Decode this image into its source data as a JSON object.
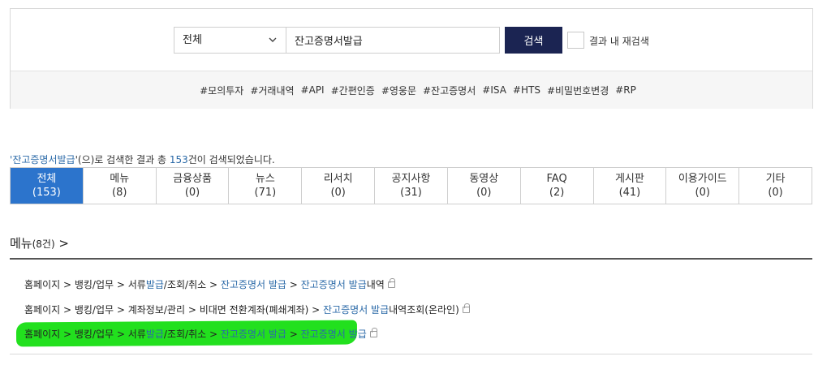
{
  "search": {
    "select_value": "전체",
    "query": "잔고증명서발급",
    "button_label": "검색",
    "recheck_label": "결과 내 재검색"
  },
  "tags": [
    "#모의투자",
    "#거래내역",
    "#API",
    "#간편인증",
    "#영웅문",
    "#잔고증명서",
    "#ISA",
    "#HTS",
    "#비밀번호변경",
    "#RP"
  ],
  "summary": {
    "open_quote": "'",
    "keyword": "잔고증명서발급",
    "mid": "'(으)로 검색한 결과 총 ",
    "count": "153",
    "tail": "건이 검색되었습니다."
  },
  "tabs": [
    {
      "label": "전체",
      "count": "(153)"
    },
    {
      "label": "메뉴",
      "count": "(8)"
    },
    {
      "label": "금융상품",
      "count": "(0)"
    },
    {
      "label": "뉴스",
      "count": "(71)"
    },
    {
      "label": "리서치",
      "count": "(0)"
    },
    {
      "label": "공지사항",
      "count": "(31)"
    },
    {
      "label": "동영상",
      "count": "(0)"
    },
    {
      "label": "FAQ",
      "count": "(2)"
    },
    {
      "label": "게시판",
      "count": "(41)"
    },
    {
      "label": "이용가이드",
      "count": "(0)"
    },
    {
      "label": "기타",
      "count": "(0)"
    }
  ],
  "section": {
    "title": "메뉴",
    "count": "(8건)",
    "arrow": " >"
  },
  "results": [
    {
      "p1": "홈페이지 > 뱅킹/업무 > 서류",
      "h1": "발급",
      "p2": "/조회/취소 > ",
      "h2": "잔고증명서 발급",
      "p3": " > ",
      "h3": "잔고증명서 발급",
      "p4": "내역"
    },
    {
      "p1": "홈페이지 > 뱅킹/업무 > 계좌정보/관리 > 비대면 전환계좌(폐쇄계좌) > ",
      "h1": "잔고증명서 발급",
      "p2": "내역조회(온라인)"
    },
    {
      "p1": "홈페이지 > 뱅킹/업무 > 서류",
      "h1": "발급",
      "p2": "/조회/취소 > ",
      "h2": "잔고증명서 발급",
      "p3": " > ",
      "h3": "잔고증명서 발급",
      "p4": ""
    }
  ],
  "colors": {
    "search_button": "#1b2452",
    "active_tab": "#2c74cc",
    "highlight_text": "#2b6aa8",
    "marker": "#22e01e"
  }
}
